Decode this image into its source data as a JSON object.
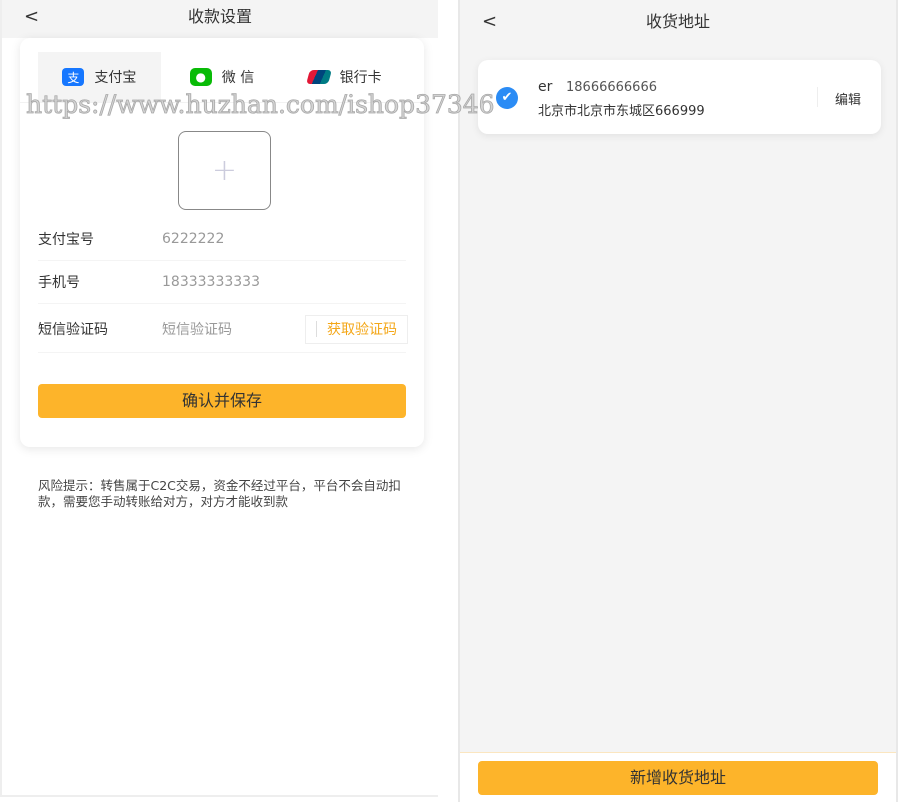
{
  "left": {
    "title": "收款设置",
    "back": "<",
    "tabs": [
      {
        "label": "支付宝",
        "icon": "alipay-icon"
      },
      {
        "label": "微 信",
        "icon": "wechat-icon"
      },
      {
        "label": "银行卡",
        "icon": "unionpay-icon"
      }
    ],
    "upload_plus": "+",
    "fields": [
      {
        "label": "支付宝号",
        "value": "6222222"
      },
      {
        "label": "手机号",
        "value": "18333333333"
      },
      {
        "label": "短信验证码",
        "placeholder": "短信验证码"
      }
    ],
    "get_code": "获取验证码",
    "save": "确认并保存",
    "tip": "风险提示：转售属于C2C交易，资金不经过平台，平台不会自动扣款，需要您手动转账给对方，对方才能收到款"
  },
  "watermark": "https://www.huzhan.com/ishop37346",
  "right": {
    "title": "收货地址",
    "back": "<",
    "address": {
      "name": "er",
      "phone": "18666666666",
      "detail": "北京市北京市东城区666999",
      "edit": "编辑"
    },
    "add": "新增收货地址"
  },
  "colors": {
    "accent": "#fdb42a",
    "check": "#2b8cf5"
  }
}
